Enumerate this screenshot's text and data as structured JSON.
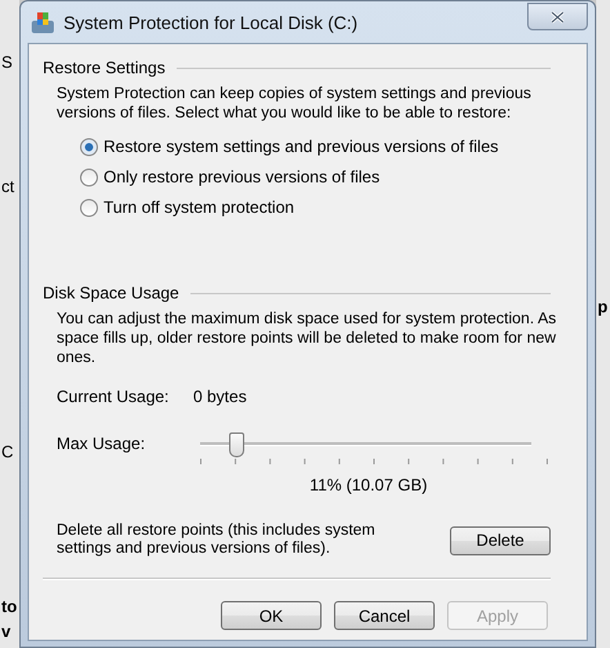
{
  "background": {
    "left_fragments": [
      "S",
      "ct",
      "C",
      "to",
      "v"
    ],
    "right_fragments": [
      "p"
    ]
  },
  "window": {
    "title": "System Protection for Local Disk (C:)"
  },
  "restore_settings": {
    "heading": "Restore Settings",
    "description": "System Protection can keep copies of system settings and previous versions of files. Select what you would like to be able to restore:",
    "options": [
      {
        "label": "Restore system settings and previous versions of files",
        "selected": true
      },
      {
        "label": "Only restore previous versions of files",
        "selected": false
      },
      {
        "label": "Turn off system protection",
        "selected": false
      }
    ]
  },
  "disk_space_usage": {
    "heading": "Disk Space Usage",
    "description": "You can adjust the maximum disk space used for system protection. As space fills up, older restore points will be deleted to make room for new ones.",
    "current_usage": {
      "label": "Current Usage:",
      "value": "0 bytes"
    },
    "max_usage": {
      "label": "Max Usage:",
      "level": 0.11,
      "reading": "11% (10.07 GB)"
    },
    "delete": {
      "text": "Delete all restore points (this includes system settings and previous versions of files).",
      "button": "Delete"
    }
  },
  "buttons": [
    {
      "label": "OK",
      "disabled": false
    },
    {
      "label": "Cancel",
      "disabled": false
    },
    {
      "label": "Apply",
      "disabled": true
    }
  ]
}
